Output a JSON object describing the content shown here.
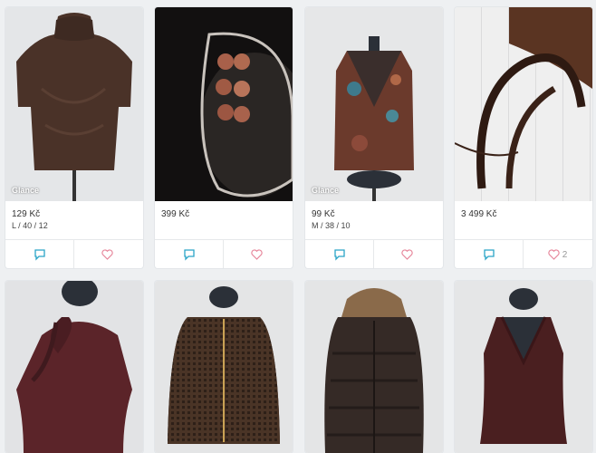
{
  "colors": {
    "comment_icon": "#2aa5c7",
    "heart_icon": "#e7899d",
    "card_bg": "#ffffff",
    "page_bg": "#eef0f2"
  },
  "items": [
    {
      "price": "129 Kč",
      "meta": "L / 40 / 12",
      "badge": "Glance",
      "likes": ""
    },
    {
      "price": "399 Kč",
      "meta": "",
      "badge": "",
      "likes": ""
    },
    {
      "price": "99 Kč",
      "meta": "M / 38 / 10",
      "badge": "Glance",
      "likes": ""
    },
    {
      "price": "3 499 Kč",
      "meta": "",
      "badge": "",
      "likes": "2"
    }
  ],
  "icons": {
    "comment": "comment-icon",
    "heart": "heart-icon"
  }
}
